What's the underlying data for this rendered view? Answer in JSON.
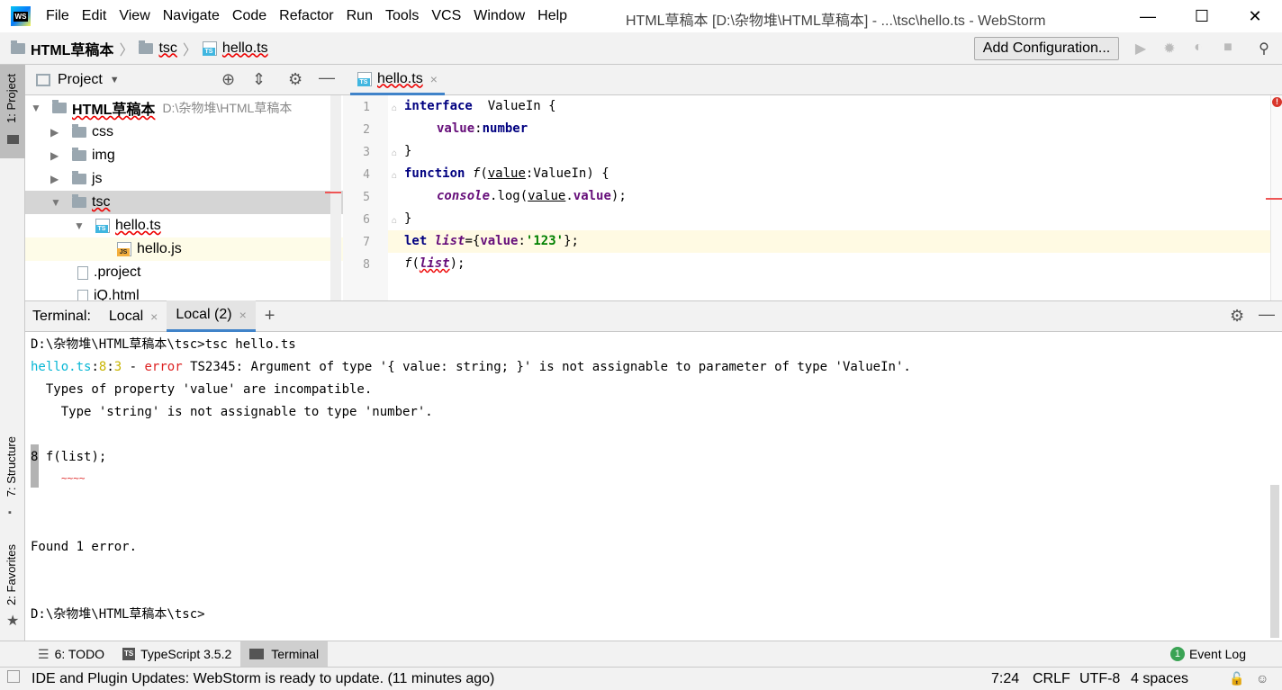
{
  "title_bar": {
    "app_logo_text": "WS",
    "menu": [
      "File",
      "Edit",
      "View",
      "Navigate",
      "Code",
      "Refactor",
      "Run",
      "Tools",
      "VCS",
      "Window",
      "Help"
    ],
    "window_title": "HTML草稿本 [D:\\杂物堆\\HTML草稿本] - ...\\tsc\\hello.ts - WebStorm",
    "minimize": "—",
    "maximize": "☐",
    "close": "✕"
  },
  "nav_bar": {
    "breadcrumbs": [
      "HTML草稿本",
      "tsc",
      "hello.ts"
    ],
    "add_configuration": "Add Configuration..."
  },
  "left_strip": {
    "project_tab": "1: Project",
    "structure_tab": "7: Structure",
    "favorites_tab": "2: Favorites"
  },
  "project_panel": {
    "title": "Project",
    "tree": [
      {
        "label": "HTML草稿本",
        "path": "D:\\杂物堆\\HTML草稿本"
      },
      {
        "label": "css"
      },
      {
        "label": "img"
      },
      {
        "label": "js"
      },
      {
        "label": "tsc"
      },
      {
        "label": "hello.ts"
      },
      {
        "label": "hello.js"
      },
      {
        "label": ".project"
      },
      {
        "label": "iQ.html"
      }
    ]
  },
  "editor": {
    "tab_label": "hello.ts",
    "tab_close": "×",
    "line_numbers": [
      "1",
      "2",
      "3",
      "4",
      "5",
      "6",
      "7",
      "8"
    ],
    "lines": {
      "l1_kw": "interface",
      "l1_rest": "  ValueIn {",
      "l2_fld": "value",
      "l2_colon": ":",
      "l2_type": "number",
      "l3": "}",
      "l4_kw": "function",
      "l4_fn": "f",
      "l4_p1": "(",
      "l4_param": "value",
      "l4_rest": ":ValueIn) {",
      "l5_console": "console",
      "l5_dot": ".log(",
      "l5_v": "value",
      "l5_dot2": ".",
      "l5_fld": "value",
      "l5_end": ");",
      "l6": "}",
      "l7_kw": "let",
      "l7_var": "list",
      "l7_eq": "={",
      "l7_fld": "value",
      "l7_colon": ":",
      "l7_str": "'123'",
      "l7_end": "};",
      "l8_fn": "f",
      "l8_p": "(",
      "l8_var": "list",
      "l8_end": ");"
    }
  },
  "terminal": {
    "label": "Terminal:",
    "tabs": [
      "Local",
      "Local (2)"
    ],
    "tab_close": "×",
    "new_tab": "+",
    "lines": {
      "cmd": "D:\\杂物堆\\HTML草稿本\\tsc>tsc hello.ts",
      "err_file": "hello.ts",
      "err_colon1": ":",
      "err_line": "8",
      "err_colon2": ":",
      "err_col": "3",
      "err_dash": " - ",
      "err_word": "error",
      "err_msg": " TS2345: Argument of type '{ value: string; }' is not assignable to parameter of type 'ValueIn'.",
      "detail1": "  Types of property 'value' are incompatible.",
      "detail2": "    Type 'string' is not assignable to type 'number'.",
      "src_num": "8",
      "src_code": " f(list);",
      "squiggle": "~~~~",
      "found": "Found 1 error.",
      "prompt": "D:\\杂物堆\\HTML草稿本\\tsc>"
    }
  },
  "bottom_tools": {
    "todo": "6: TODO",
    "typescript": "TypeScript 3.5.2",
    "terminal": "Terminal",
    "event_count": "1",
    "event_log": "Event Log"
  },
  "status_bar": {
    "message": "IDE and Plugin Updates: WebStorm is ready to update. (11 minutes ago)",
    "position": "7:24",
    "line_sep": "CRLF",
    "encoding": "UTF-8",
    "indent": "4 spaces"
  }
}
